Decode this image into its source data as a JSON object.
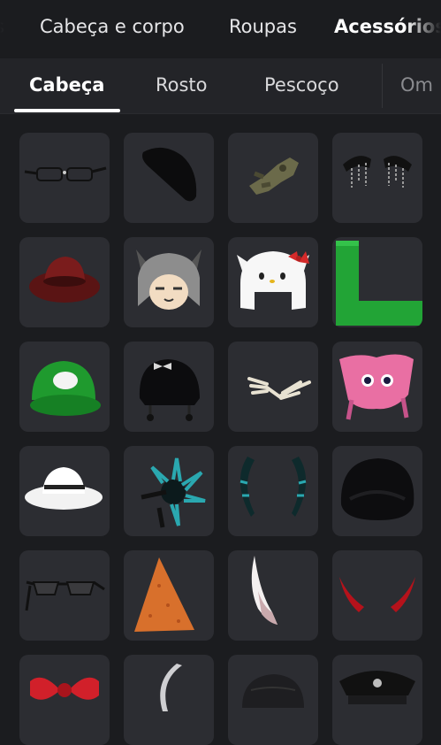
{
  "categories": {
    "prev_fragment": "s",
    "items": [
      "Cabeça e corpo",
      "Roupas",
      "Acessórios"
    ],
    "active": "Acessórios"
  },
  "subcategories": {
    "items": [
      "Cabeça",
      "Rosto",
      "Pescoço",
      "Om"
    ],
    "active": "Cabeça"
  },
  "items": [
    {
      "icon": "rimless-glasses-icon"
    },
    {
      "icon": "black-beret-icon"
    },
    {
      "icon": "camo-glove-icon"
    },
    {
      "icon": "chain-hair-clips-icon"
    },
    {
      "icon": "red-cowboy-hat-icon"
    },
    {
      "icon": "gray-cat-hair-icon"
    },
    {
      "icon": "hello-kitty-hat-icon"
    },
    {
      "icon": "green-letter-l-icon"
    },
    {
      "icon": "green-cap-icon"
    },
    {
      "icon": "black-bow-beanie-icon"
    },
    {
      "icon": "skeleton-hands-icon"
    },
    {
      "icon": "pink-creature-hat-icon"
    },
    {
      "icon": "white-cowboy-hat-icon"
    },
    {
      "icon": "teal-spike-crown-icon"
    },
    {
      "icon": "teal-horns-icon"
    },
    {
      "icon": "black-hood-icon"
    },
    {
      "icon": "sunglasses-icon"
    },
    {
      "icon": "orange-chip-icon"
    },
    {
      "icon": "white-horn-icon"
    },
    {
      "icon": "red-devil-horns-icon"
    },
    {
      "icon": "red-bow-icon"
    },
    {
      "icon": "silver-crescent-icon"
    },
    {
      "icon": "black-cap-icon"
    },
    {
      "icon": "police-hat-icon"
    }
  ],
  "colors": {
    "background": "#1b1c1f",
    "subbar": "#232428",
    "tile": "#2c2d32",
    "text": "#ffffff"
  }
}
